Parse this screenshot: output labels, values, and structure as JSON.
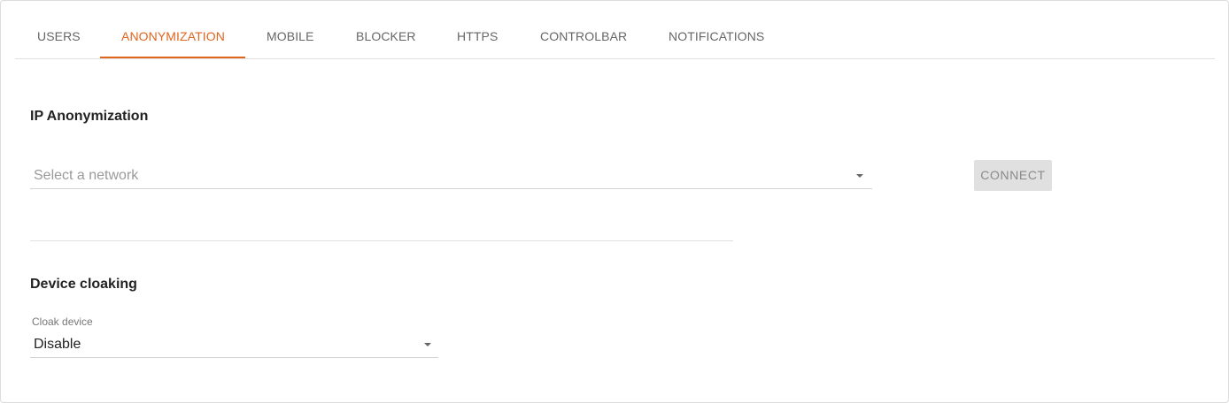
{
  "tabs": [
    {
      "label": "USERS"
    },
    {
      "label": "ANONYMIZATION",
      "active": true
    },
    {
      "label": "MOBILE"
    },
    {
      "label": "BLOCKER"
    },
    {
      "label": "HTTPS"
    },
    {
      "label": "CONTROLBAR"
    },
    {
      "label": "NOTIFICATIONS"
    }
  ],
  "ip_section": {
    "title": "IP Anonymization",
    "network_select_placeholder": "Select a network",
    "connect_label": "CONNECT",
    "connect_enabled": false
  },
  "cloak_section": {
    "title": "Device cloaking",
    "field_label": "Cloak device",
    "selected_value": "Disable"
  },
  "colors": {
    "accent": "#e0651d",
    "tab_text": "#666666",
    "button_disabled_bg": "#e0e0e0"
  },
  "icons": {
    "dropdown": "caret-down-icon"
  }
}
